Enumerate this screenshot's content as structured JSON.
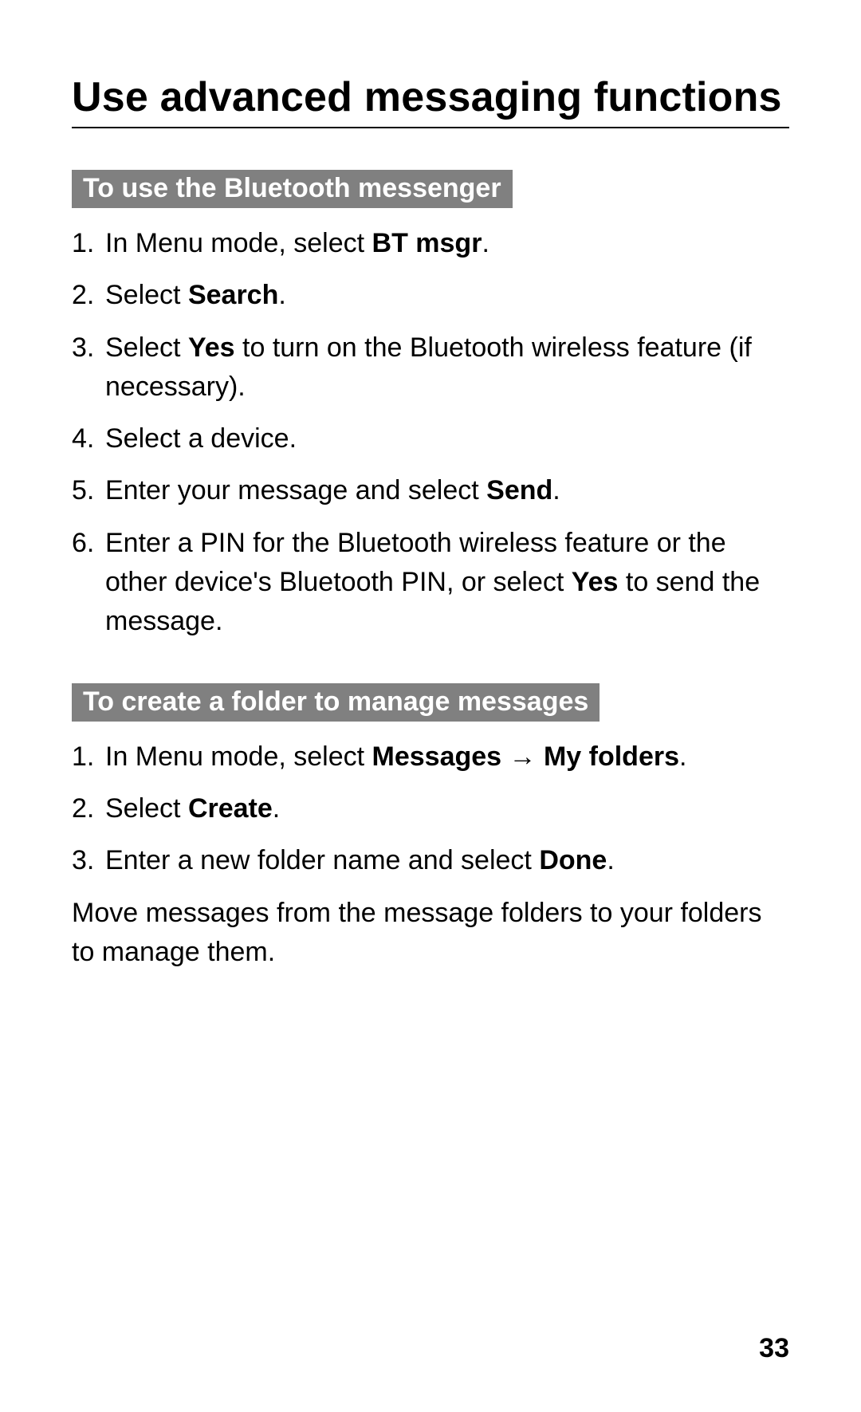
{
  "title": "Use advanced messaging functions",
  "page_number": "33",
  "sections": [
    {
      "header": "To use the Bluetooth messenger",
      "items": [
        [
          {
            "t": "In Menu mode, select "
          },
          {
            "t": "BT msgr",
            "b": true
          },
          {
            "t": "."
          }
        ],
        [
          {
            "t": "Select "
          },
          {
            "t": "Search",
            "b": true
          },
          {
            "t": "."
          }
        ],
        [
          {
            "t": "Select "
          },
          {
            "t": "Yes",
            "b": true
          },
          {
            "t": " to turn on the Bluetooth wireless feature (if necessary)."
          }
        ],
        [
          {
            "t": "Select a device."
          }
        ],
        [
          {
            "t": "Enter your message and select "
          },
          {
            "t": "Send",
            "b": true
          },
          {
            "t": "."
          }
        ],
        [
          {
            "t": "Enter a PIN for the Bluetooth wireless feature or the other device's Bluetooth PIN, or select "
          },
          {
            "t": "Yes",
            "b": true
          },
          {
            "t": " to send the message."
          }
        ]
      ]
    },
    {
      "header": "To create a folder to manage messages",
      "items": [
        [
          {
            "t": "In Menu mode, select "
          },
          {
            "t": "Messages",
            "b": true
          },
          {
            "t": " → "
          },
          {
            "t": "My folders",
            "b": true
          },
          {
            "t": "."
          }
        ],
        [
          {
            "t": "Select "
          },
          {
            "t": "Create",
            "b": true
          },
          {
            "t": "."
          }
        ],
        [
          {
            "t": "Enter a new folder name and select "
          },
          {
            "t": "Done",
            "b": true
          },
          {
            "t": "."
          }
        ]
      ],
      "paragraph": [
        {
          "t": "Move messages from the message folders to your folders to manage them."
        }
      ]
    }
  ]
}
